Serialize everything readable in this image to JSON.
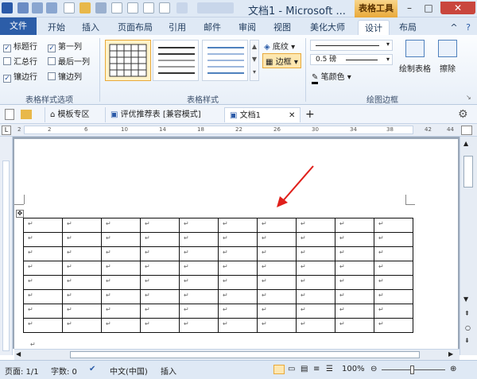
{
  "title": {
    "app_title": "文档1 - Microsoft ...",
    "context_tab": "表格工具",
    "min": "–",
    "max": "□",
    "close": "✕"
  },
  "tabs": [
    {
      "label": "文件"
    },
    {
      "label": "开始"
    },
    {
      "label": "插入"
    },
    {
      "label": "页面布局"
    },
    {
      "label": "引用"
    },
    {
      "label": "邮件"
    },
    {
      "label": "审阅"
    },
    {
      "label": "视图"
    },
    {
      "label": "美化大师"
    },
    {
      "label": "设计"
    },
    {
      "label": "布局"
    }
  ],
  "ribbon": {
    "options": {
      "header_row": "标题行",
      "first_col": "第一列",
      "total_row": "汇总行",
      "last_col": "最后一列",
      "banded_rows": "镶边行",
      "banded_cols": "镶边列",
      "group_label": "表格样式选项"
    },
    "styles": {
      "shading": "底纹",
      "borders": "边框",
      "group_label": "表格样式"
    },
    "borders": {
      "pen_weight": "0.5 磅",
      "pen_color": "笔颜色",
      "draw_table": "绘制表格",
      "eraser": "擦除",
      "group_label": "绘图边框"
    }
  },
  "docbar": {
    "tab1": "模板专区",
    "tab2": "评优推荐表 [兼容模式]",
    "tab3": "文档1",
    "close": "✕",
    "add": "+"
  },
  "ruler_numbers": [
    "2",
    "2",
    "6",
    "10",
    "14",
    "18",
    "22",
    "26",
    "30",
    "34",
    "38",
    "42",
    "44"
  ],
  "table": {
    "rows": 8,
    "cols": 10,
    "cell_mark": "↵"
  },
  "status": {
    "page": "页面: 1/1",
    "words": "字数: 0",
    "language": "中文(中国)",
    "mode": "插入",
    "zoom": "100%"
  },
  "colors": {
    "accent": "#2c5da8",
    "context": "#e9a93a",
    "arrow": "#e0201b"
  }
}
